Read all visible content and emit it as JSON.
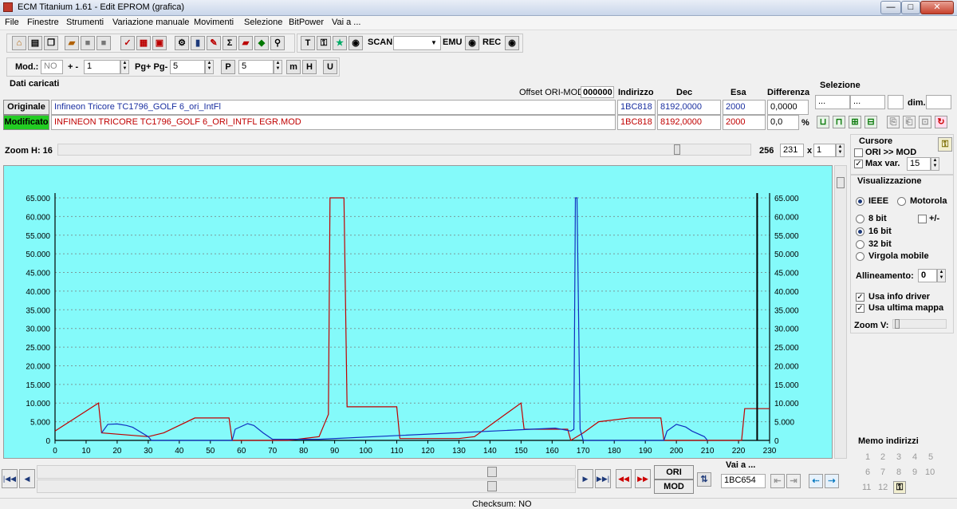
{
  "window": {
    "title": "ECM Titanium 1.61 - Edit EPROM (grafica)",
    "min_label": "—",
    "max_label": "□",
    "close_label": "✕"
  },
  "menu": [
    "File",
    "Finestre",
    "Strumenti",
    "Variazione manuale",
    "Movimenti",
    "Selezione",
    "BitPower",
    "Vai a ..."
  ],
  "toolbar1": {
    "scan_label": "SCAN",
    "emu_label": "EMU",
    "rec_label": "REC",
    "sigma": "Σ"
  },
  "toolbar2": {
    "mod_label": "Mod.:",
    "mod_value": "NO",
    "plusminus_label": "+ -",
    "step_value": "1",
    "pg_label": "Pg+ Pg-",
    "pg_value": "5",
    "p_icon": "P",
    "p_value": "5",
    "m_icon": "m",
    "h_icon": "H",
    "u_icon": "U"
  },
  "data_section": {
    "title": "Dati caricati",
    "offset_label": "Offset ORI-MOD",
    "offset_value": "000000",
    "col_indirizzo": "Indirizzo",
    "col_dec": "Dec",
    "col_esa": "Esa",
    "col_diff": "Differenza",
    "selezione_title": "Selezione",
    "dim_label": "dim.",
    "sel_from": "...",
    "sel_to": "...",
    "originale": {
      "label": "Originale",
      "file": "Infineon Tricore TC1796_GOLF 6_ori_IntFl",
      "address": "1BC818",
      "dec": "8192,0000",
      "esa": "2000",
      "diff": "0,0000"
    },
    "modificato": {
      "label": "Modificato",
      "file": "INFINEON TRICORE TC1796_GOLF 6_ORI_INTFL EGR.MOD",
      "address": "1BC818",
      "dec": "8192,0000",
      "esa": "2000",
      "diff": "0,0",
      "percent": "%"
    }
  },
  "zoom": {
    "label": "Zoom H: 16",
    "max": "256",
    "value": "231",
    "times": "x",
    "factor": "1"
  },
  "right_panel": {
    "cursore_title": "Cursore",
    "ori_mod_label": "ORI >> MOD",
    "max_var_label": "Max var.",
    "max_var_value": "15",
    "visualizzazione_title": "Visualizzazione",
    "ieee_label": "IEEE",
    "motorola_label": "Motorola",
    "bit8_label": "8 bit",
    "plusminus_label": "+/-",
    "bit16_label": "16 bit",
    "bit32_label": "32 bit",
    "float_label": "Virgola mobile",
    "allineamento_label": "Allineamento:",
    "allineamento_value": "0",
    "usa_info_driver": "Usa info driver",
    "usa_ultima_mappa": "Usa ultima mappa",
    "zoom_v_label": "Zoom V:",
    "memo_title": "Memo indirizzi",
    "memo_numbers": [
      "1",
      "2",
      "3",
      "4",
      "5",
      "6",
      "7",
      "8",
      "9",
      "10",
      "11",
      "12"
    ]
  },
  "bottom": {
    "ori_label": "ORI",
    "mod_label": "MOD",
    "vai_label": "Vai a ...",
    "vai_value": "1BC654",
    "checksum": "Checksum: NO"
  },
  "chart_data": {
    "type": "line",
    "x_ticks": [
      0,
      10,
      20,
      30,
      40,
      50,
      60,
      70,
      80,
      90,
      100,
      110,
      120,
      130,
      140,
      150,
      160,
      170,
      180,
      190,
      200,
      210,
      220,
      230
    ],
    "y_ticks": [
      "0",
      "5.000",
      "10.000",
      "15.000",
      "20.000",
      "25.000",
      "30.000",
      "35.000",
      "40.000",
      "45.000",
      "50.000",
      "55.000",
      "60.000",
      "65.000"
    ],
    "xlim": [
      0,
      230
    ],
    "ylim": [
      0,
      65000
    ],
    "grid": true,
    "cursor_x": 226,
    "series": [
      {
        "color": "#c00000",
        "x": [
          0,
          14,
          15,
          30,
          35,
          45,
          56,
          57,
          75,
          85,
          88,
          88.5,
          93,
          94,
          110,
          111,
          130,
          135,
          150,
          151,
          156,
          165,
          166,
          170,
          175,
          185,
          195,
          196,
          220,
          221,
          222,
          230
        ],
        "y": [
          2500,
          10000,
          2000,
          1000,
          2000,
          6000,
          6000,
          0,
          0,
          1000,
          7000,
          65000,
          65000,
          9000,
          9000,
          500,
          500,
          1000,
          10000,
          3000,
          3000,
          3000,
          0,
          2000,
          5000,
          6000,
          6000,
          0,
          0,
          0,
          8500,
          8500
        ]
      },
      {
        "color": "#1030c0",
        "x": [
          15,
          17,
          20,
          23,
          25,
          30,
          31,
          57,
          58,
          62,
          64,
          67,
          70,
          85,
          161,
          166,
          167,
          167.5,
          168,
          169,
          170,
          196,
          197,
          200,
          203,
          205,
          209,
          210
        ],
        "y": [
          2000,
          4300,
          4400,
          4000,
          3500,
          1000,
          0,
          0,
          3000,
          4500,
          4000,
          2000,
          300,
          300,
          3300,
          2500,
          3000,
          65000,
          65000,
          3000,
          0,
          0,
          2500,
          4300,
          3600,
          2500,
          1000,
          0
        ]
      }
    ]
  }
}
